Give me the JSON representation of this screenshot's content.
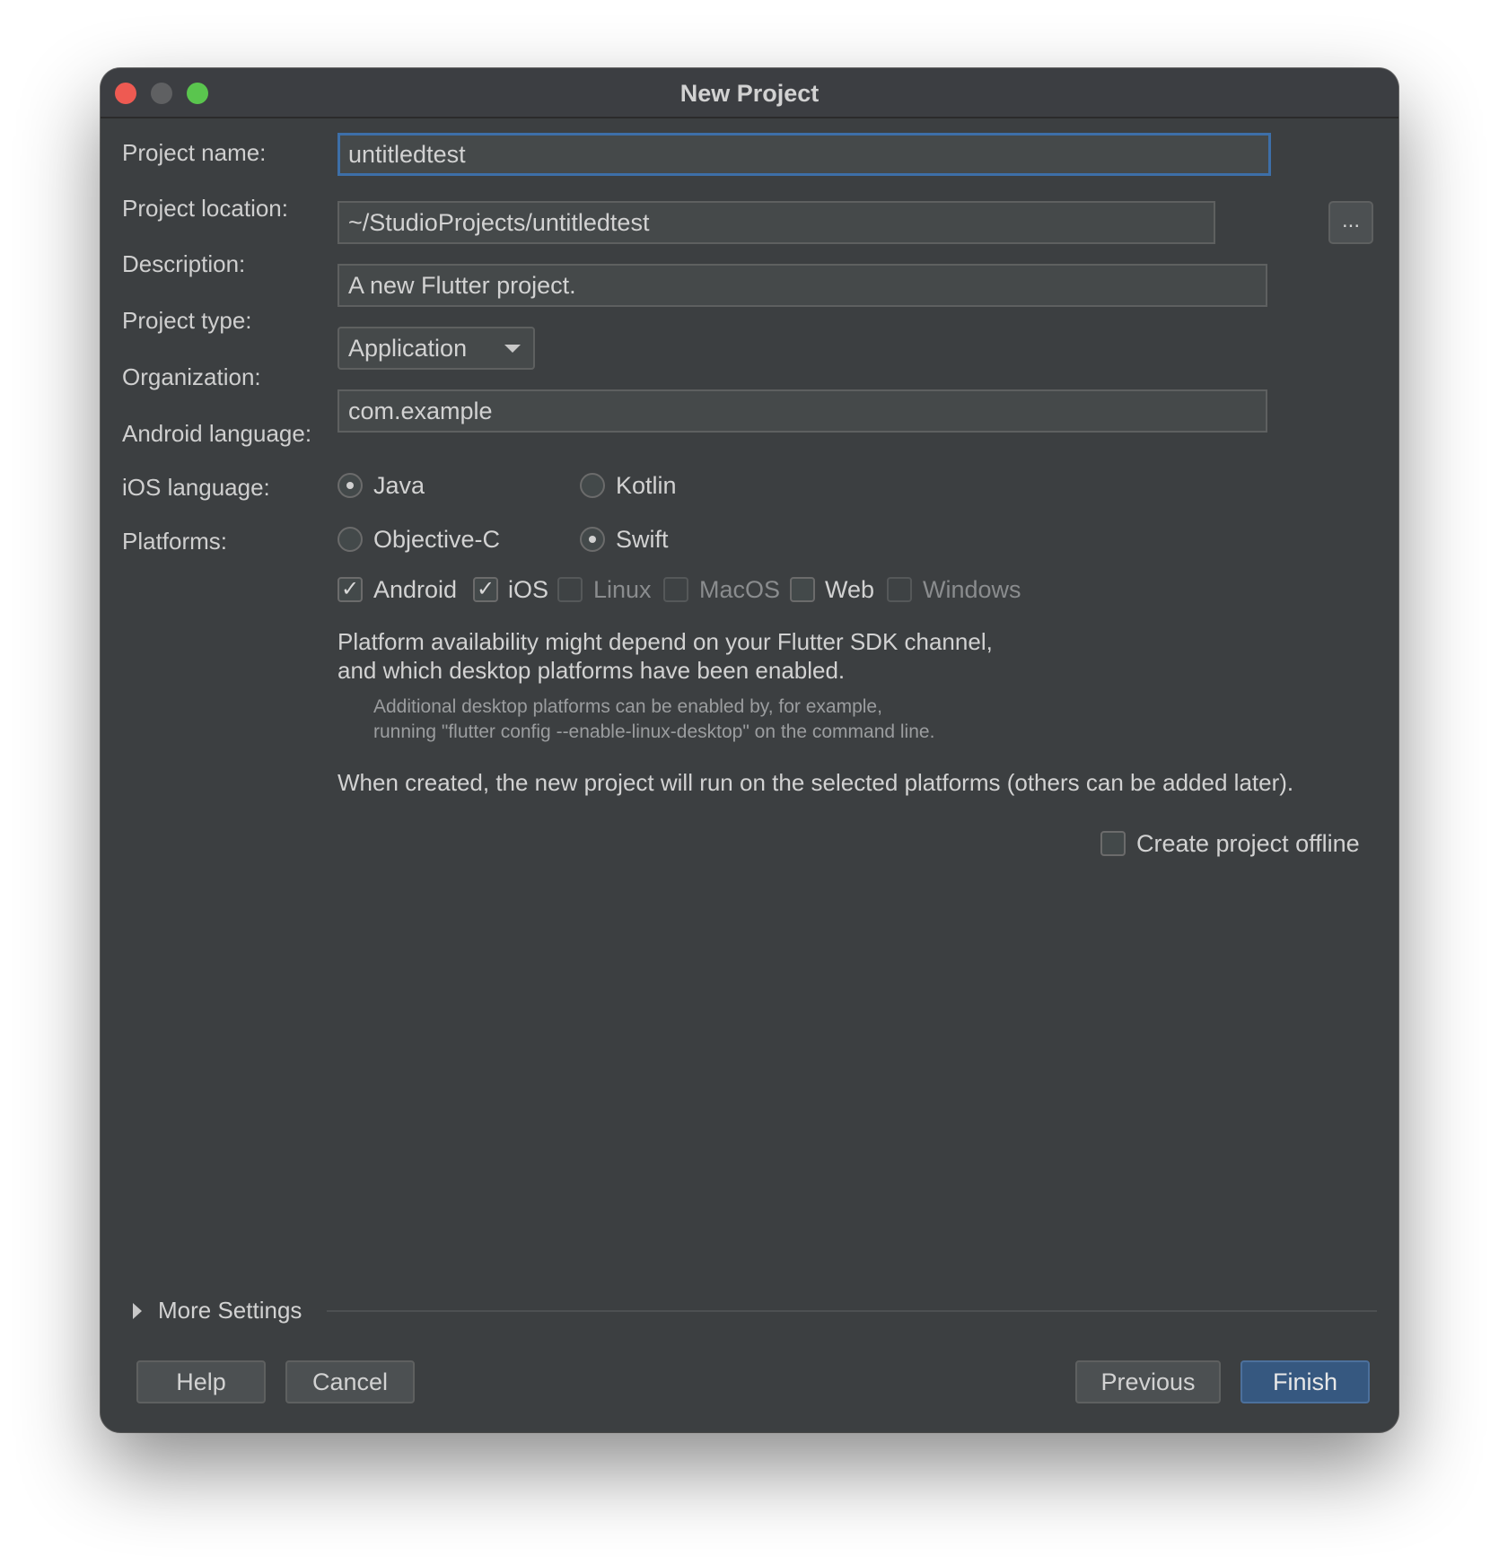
{
  "window": {
    "title": "New Project"
  },
  "form": {
    "project_name": {
      "label": "Project name:",
      "value": "untitledtest"
    },
    "project_location": {
      "label": "Project location:",
      "value": "~/StudioProjects/untitledtest",
      "browse_label": "..."
    },
    "description": {
      "label": "Description:",
      "value": "A new Flutter project."
    },
    "project_type": {
      "label": "Project type:",
      "value": "Application"
    },
    "organization": {
      "label": "Organization:",
      "value": "com.example"
    },
    "android_language": {
      "label": "Android language:",
      "options": [
        {
          "label": "Java",
          "selected": true
        },
        {
          "label": "Kotlin",
          "selected": false
        }
      ]
    },
    "ios_language": {
      "label": "iOS language:",
      "options": [
        {
          "label": "Objective-C",
          "selected": false
        },
        {
          "label": "Swift",
          "selected": true
        }
      ]
    },
    "platforms": {
      "label": "Platforms:",
      "items": [
        {
          "label": "Android",
          "checked": true,
          "enabled": true
        },
        {
          "label": "iOS",
          "checked": true,
          "enabled": true
        },
        {
          "label": "Linux",
          "checked": false,
          "enabled": false
        },
        {
          "label": "MacOS",
          "checked": false,
          "enabled": false
        },
        {
          "label": "Web",
          "checked": false,
          "enabled": true
        },
        {
          "label": "Windows",
          "checked": false,
          "enabled": false
        }
      ]
    },
    "platform_info": {
      "line1": "Platform availability might depend on your Flutter SDK channel,",
      "line2": "and which desktop platforms have been enabled."
    },
    "platform_note": {
      "line1": "Additional desktop platforms can be enabled by, for example,",
      "line2": "running \"flutter config --enable-linux-desktop\" on the command line."
    },
    "platform_summary": "When created, the new project will run on the selected platforms (others can be added later).",
    "create_offline": {
      "label": "Create project offline",
      "checked": false
    }
  },
  "more_settings": {
    "label": "More Settings"
  },
  "buttons": {
    "help": "Help",
    "cancel": "Cancel",
    "previous": "Previous",
    "finish": "Finish"
  }
}
